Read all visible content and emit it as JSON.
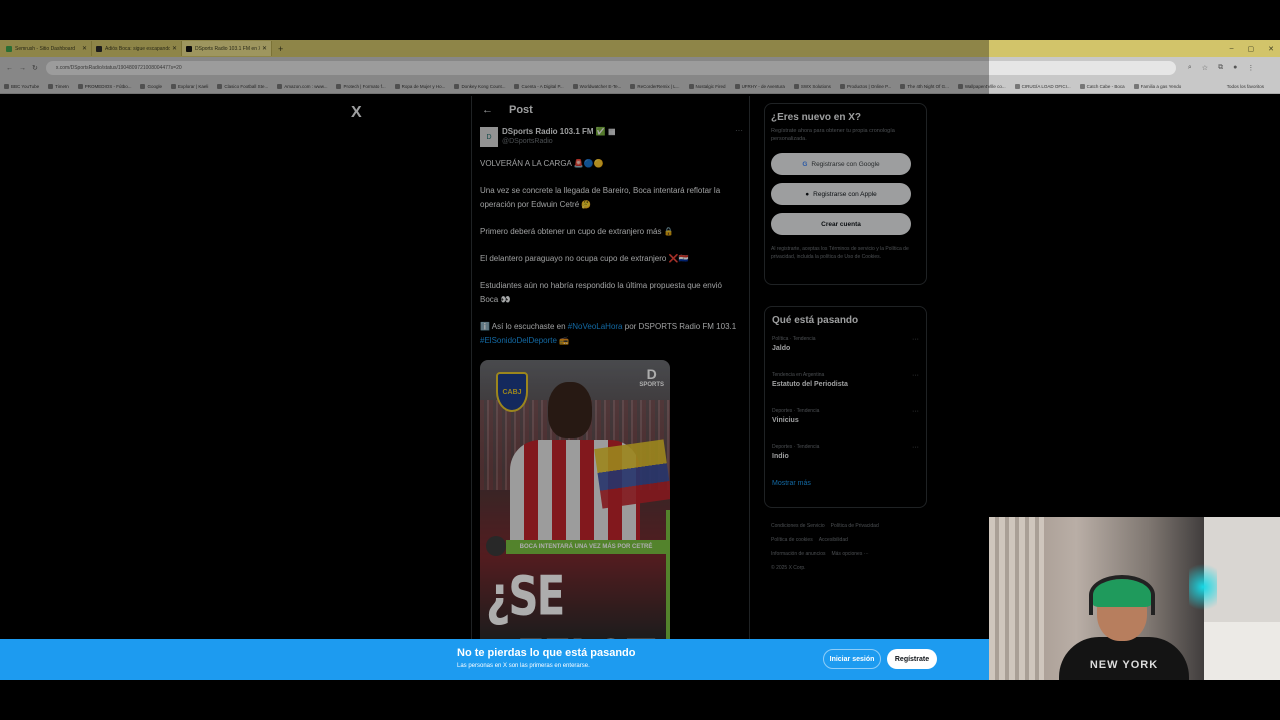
{
  "browser": {
    "tabs": [
      {
        "label": "Semrush - Sitio Dashboard",
        "favicon_color": "#3fa34d"
      },
      {
        "label": "Adiós Boca: sigue escapando",
        "favicon_color": "#2a2a2a"
      },
      {
        "label": "DSports Radio 103.1 FM en X:",
        "favicon_color": "#111111",
        "active": true
      }
    ],
    "new_tab": "+",
    "window_controls": [
      "–",
      "▢",
      "✕"
    ],
    "url": "x.com/DSportsRadio/status/1904809721008004477s=20",
    "bookmarks": [
      "BBC YouTube",
      "TimeIn",
      "PROMEDIOS - Fútbo...",
      "Google",
      "Explorar | Kaeli",
      "Clasico Football Ste...",
      "Amazon.com : www...",
      "Protech | Formato f...",
      "Ropa de Mujer y Ho...",
      "Donkey Kong Count...",
      "Cuenta - A Digital P...",
      "Worldwatcher E-Te...",
      "ReCorderRemix | L...",
      "Nostalgic Fired",
      "UFRHY - de Aventura",
      "SWX Solutions",
      "Productos | Online P...",
      "The 4th Night Of G...",
      "Wallpaper4Ville co...",
      "CIRUGÍA LOAD OFICI...",
      "Catch Cabe - Boca",
      "Familia a gas Yendo"
    ],
    "bookmarks_right": "Todos los favoritos"
  },
  "x": {
    "logo": "X",
    "post_header": "Post",
    "author": {
      "name": "DSports Radio 103.1 FM ✅ ▦",
      "handle": "@DSportsRadio",
      "avatar_text": "D",
      "more": "···"
    },
    "post_paragraphs": [
      "VOLVERÁN A LA CARGA 🚨🔵🟡",
      "Una vez se concrete la llegada de Bareiro, Boca intentará reflotar la operación por Edwuin Cetré 🤔",
      "Primero deberá obtener un cupo de extranjero más 🔒",
      "El delantero paraguayo no ocupa cupo de extranjero ❌🇵🇾",
      "Estudiantes aún no habría respondido la última propuesta que envió Boca 👀"
    ],
    "post_last_line_prefix": "ℹ️ Así lo escuchaste en ",
    "hashtag1": "#NoVeoLaHora",
    "post_last_line_mid": " por DSPORTS Radio FM 103.1",
    "hashtag2": "#ElSonidoDelDeporte",
    "post_last_line_suffix": " 📻",
    "image": {
      "badge": "CABJ",
      "brand": "SPORTS",
      "brand_letter": "D",
      "banner": "BOCA INTENTARÁ UNA VEZ MÁS POR CETRÉ",
      "headline": "¿SE REFLOTA?"
    }
  },
  "sidebar": {
    "new_title": "¿Eres nuevo en X?",
    "new_desc": "Regístrate ahora para obtener tu propia cronología personalizada.",
    "google_btn": "Registrarse con Google",
    "apple_btn": "Registrarse con Apple",
    "create_btn": "Crear cuenta",
    "terms": "Al registrarte, aceptas los Términos de servicio y la Política de privacidad, incluida la política de Uso de Cookies.",
    "trends_title": "Qué está pasando",
    "trends": [
      {
        "category": "Política · Tendencia",
        "name": "Jaldo"
      },
      {
        "category": "Tendencia en Argentina",
        "name": "Estatuto del Periodista"
      },
      {
        "category": "Deportes · Tendencia",
        "name": "Vinicius"
      },
      {
        "category": "Deportes · Tendencia",
        "name": "Indio"
      }
    ],
    "show_more": "Mostrar más",
    "footer": [
      "Condiciones de Servicio",
      "Política de Privacidad",
      "Política de cookies",
      "Accesibilidad",
      "Información de anuncios",
      "Más opciones ···",
      "© 2025 X Corp."
    ]
  },
  "bottom_bar": {
    "title": "No te pierdas lo que está pasando",
    "subtitle": "Las personas en X son las primeras en enterarse.",
    "login": "Iniciar sesión",
    "signup": "Regístrate"
  },
  "webcam": {
    "shirt_text": "NEW YORK"
  }
}
